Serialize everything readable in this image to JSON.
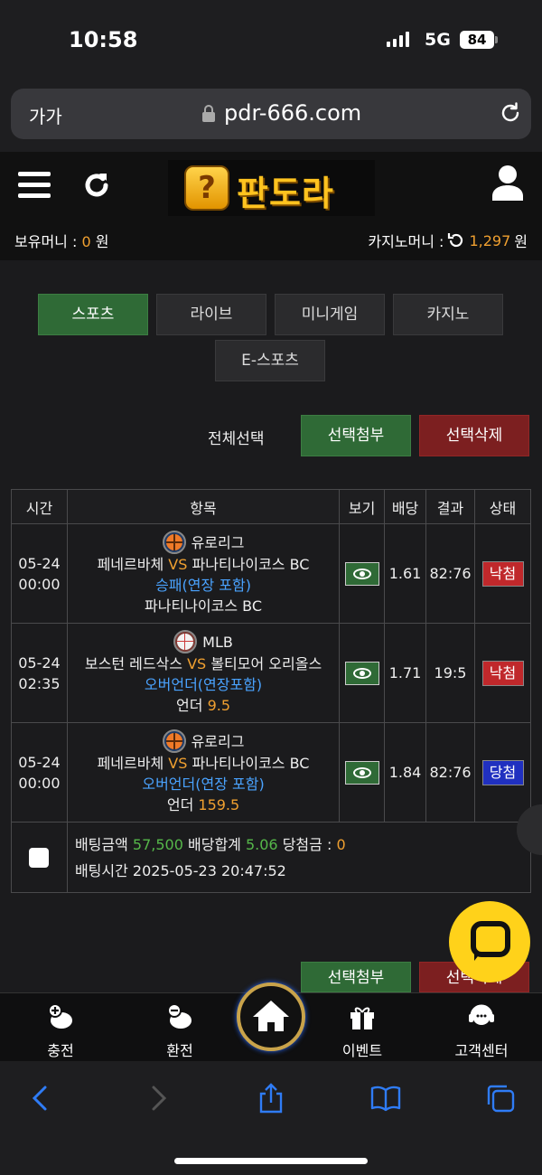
{
  "status": {
    "time": "10:58",
    "network": "5G",
    "battery": "84"
  },
  "browser": {
    "aa": "가가",
    "url": "pdr-666.com"
  },
  "site": {
    "logo_text": "판도라",
    "logo_badge": "?",
    "balance_label": "보유머니 :",
    "balance_value": "0",
    "balance_unit": "원",
    "casino_label": "카지노머니 :",
    "casino_value": "1,297",
    "casino_unit": "원"
  },
  "tabs": [
    "스포츠",
    "라이브",
    "미니게임",
    "카지노",
    "E-스포츠"
  ],
  "actions": {
    "select_all": "전체선택",
    "attach": "선택첨부",
    "delete": "선택삭제"
  },
  "table": {
    "headers": [
      "시간",
      "항목",
      "보기",
      "배당",
      "결과",
      "상태"
    ],
    "rows": [
      {
        "date": "05-24",
        "time": "00:00",
        "league": "유로리그",
        "sport": "basketball",
        "home": "페네르바체",
        "vs": "VS",
        "away": "파나티나이코스 BC",
        "market": "승패(연장 포함)",
        "pick": "파나티나이코스 BC",
        "pick_value": "",
        "odds": "1.61",
        "result": "82:76",
        "status": "낙첨"
      },
      {
        "date": "05-24",
        "time": "02:35",
        "league": "MLB",
        "sport": "baseball",
        "home": "보스턴 레드삭스",
        "vs": "VS",
        "away": "볼티모어 오리올스",
        "market": "오버언더(연장포함)",
        "pick": "언더",
        "pick_value": "9.5",
        "odds": "1.71",
        "result": "19:5",
        "status": "낙첨"
      },
      {
        "date": "05-24",
        "time": "00:00",
        "league": "유로리그",
        "sport": "basketball",
        "home": "페네르바체",
        "vs": "VS",
        "away": "파나티나이코스 BC",
        "market": "오버언더(연장 포함)",
        "pick": "언더",
        "pick_value": "159.5",
        "odds": "1.84",
        "result": "82:76",
        "status": "당첨"
      }
    ],
    "summary": {
      "bet_amount_label": "배팅금액",
      "bet_amount": "57,500",
      "total_odds_label": "배당합계",
      "total_odds": "5.06",
      "winnings_label": "당첨금 :",
      "winnings": "0",
      "bet_time_label": "배팅시간",
      "bet_time": "2025-05-23 20:47:52"
    }
  },
  "bottom_actions": {
    "attach": "선택첨부",
    "delete": "선택삭제"
  },
  "nav": {
    "deposit": "충전",
    "withdraw": "환전",
    "event": "이벤트",
    "support": "고객센터"
  },
  "colors": {
    "green": "#2f6a36",
    "red": "#7c1f20",
    "lose": "#c0282b",
    "win": "#2030c0",
    "accent": "#f0a030",
    "link": "#4aa3ff",
    "odds": "#56b84a"
  },
  "icons": [
    "hamburger-icon",
    "refresh-icon",
    "user-icon",
    "lock-icon",
    "reload-icon",
    "eye-icon",
    "basketball-icon",
    "baseball-icon",
    "chat-icon",
    "home-icon",
    "gift-icon",
    "headset-icon",
    "piggy-plus-icon",
    "piggy-minus-icon",
    "back-icon",
    "forward-icon",
    "share-icon",
    "bookmarks-icon",
    "tabs-icon"
  ]
}
